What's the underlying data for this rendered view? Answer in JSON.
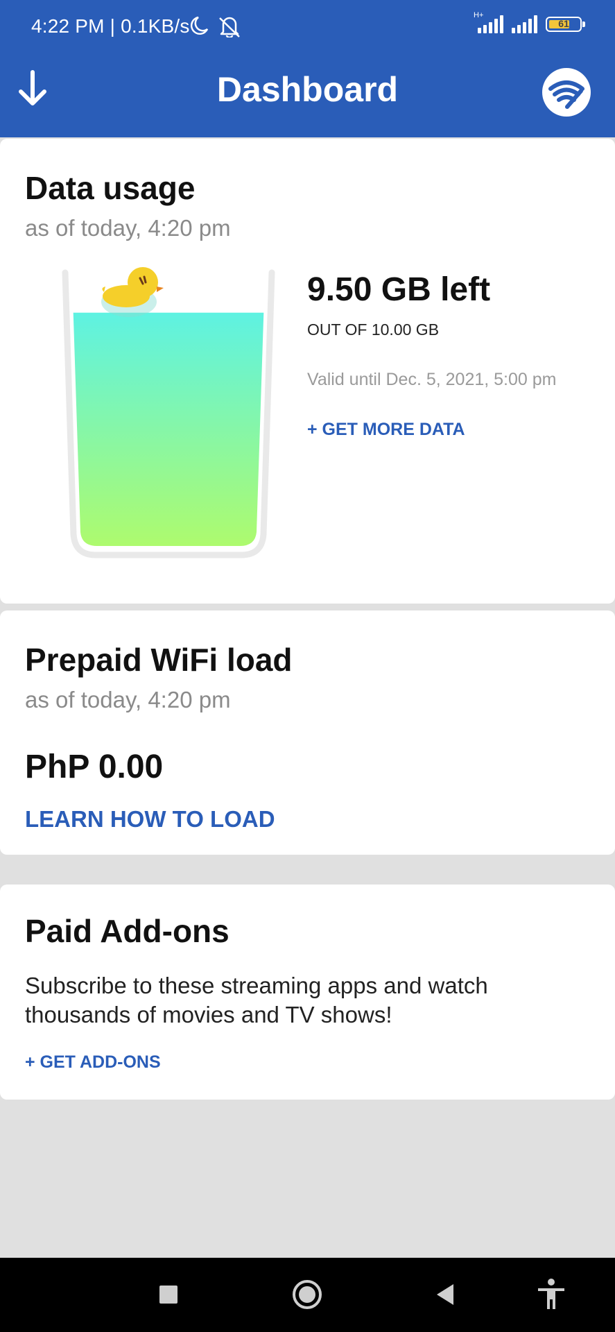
{
  "status_bar": {
    "time": "4:22 PM | 0.1KB/s",
    "network_type": "H+",
    "battery_percent": "61"
  },
  "app_bar": {
    "title": "Dashboard"
  },
  "data_usage": {
    "title": "Data usage",
    "as_of": "as of today, 4:20 pm",
    "remaining": "9.50 GB left",
    "out_of": "OUT OF 10.00 GB",
    "validity": "Valid until Dec. 5, 2021, 5:00 pm",
    "get_more_label": "+ GET MORE DATA",
    "fill_fraction": 0.95,
    "colors": {
      "liquid_top": "#5ef2e2",
      "liquid_bottom": "#b0fb6a",
      "duck": "#f5cf2a"
    }
  },
  "prepaid": {
    "title": "Prepaid WiFi load",
    "as_of": "as of today, 4:20 pm",
    "amount": "PhP 0.00",
    "learn_label": "LEARN HOW TO LOAD"
  },
  "addons": {
    "title": "Paid Add-ons",
    "description": "Subscribe to these streaming apps and watch thousands of movies and TV shows!",
    "get_label": "+ GET ADD-ONS"
  },
  "icons": {
    "back": "download-arrow-icon",
    "wifi": "wifi-logo-icon",
    "nav_recent": "square-icon",
    "nav_home": "circle-icon",
    "nav_back": "triangle-back-icon",
    "nav_accessibility": "accessibility-icon"
  },
  "theme": {
    "primary": "#2a5db8",
    "background": "#e0e0e0"
  }
}
